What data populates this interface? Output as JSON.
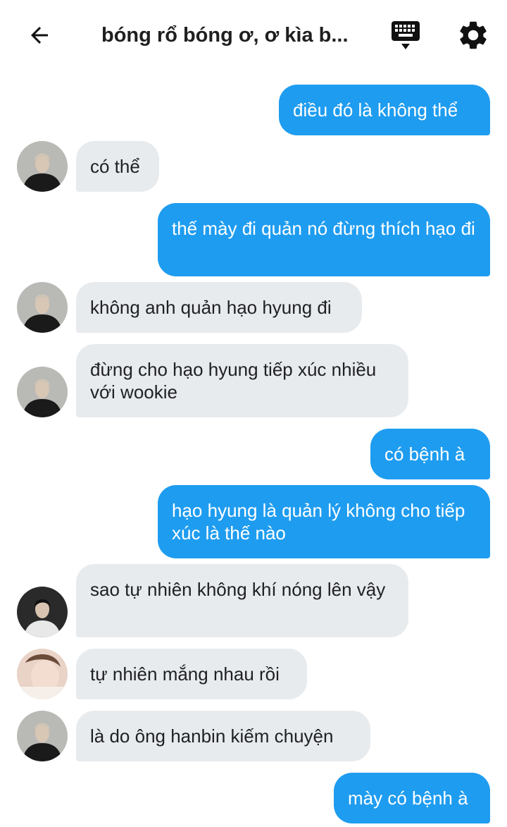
{
  "header": {
    "title": "bóng rổ bóng ơ, ơ kìa b..."
  },
  "icons": {
    "back": "arrow-left-icon",
    "keyboard": "keyboard-icon",
    "settings": "gear-icon"
  },
  "colors": {
    "outgoing_bubble": "#1e9cf0",
    "incoming_bubble": "#e8ebee"
  },
  "messages": [
    {
      "side": "right",
      "text": "điều đó là không thể"
    },
    {
      "side": "left",
      "avatar": "a",
      "text": "có thể"
    },
    {
      "side": "right",
      "text": "thế mày đi quản nó đừng thích hạo đi"
    },
    {
      "side": "left",
      "avatar": "a",
      "text": "không anh quản hạo hyung đi"
    },
    {
      "side": "left",
      "avatar": "a",
      "text": "đừng cho hạo hyung tiếp xúc nhiều với wookie"
    },
    {
      "side": "right",
      "text": "có bệnh à"
    },
    {
      "side": "right",
      "text": "hạo hyung là quản lý không cho tiếp xúc là thế nào"
    },
    {
      "side": "left",
      "avatar": "b",
      "text": "sao tự nhiên không khí nóng lên vậy"
    },
    {
      "side": "left",
      "avatar": "c",
      "text": "tự nhiên mắng nhau rồi"
    },
    {
      "side": "left",
      "avatar": "a",
      "text": "là do ông hanbin kiếm chuyện"
    },
    {
      "side": "right",
      "text": "mày có bệnh à"
    }
  ]
}
